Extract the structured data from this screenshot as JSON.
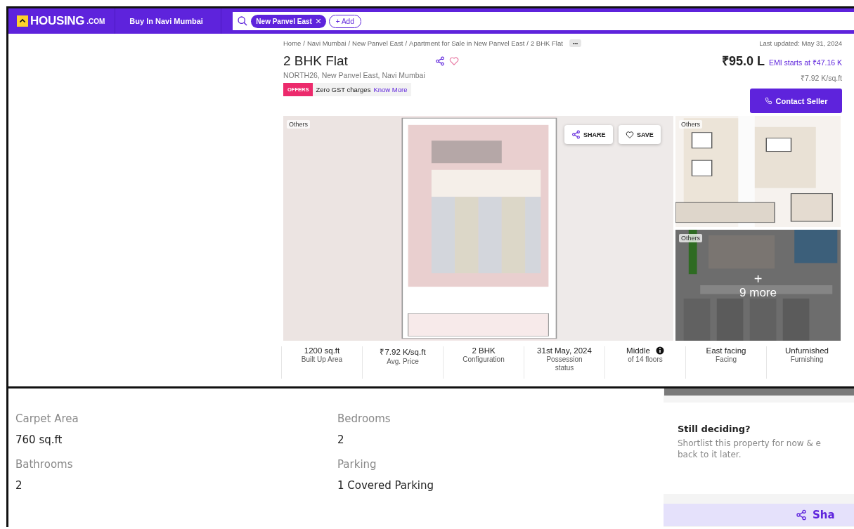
{
  "nav": {
    "logo": "HOUSING",
    "logo_suffix": ".COM",
    "menu": "Buy In Navi Mumbai",
    "search_chips": [
      {
        "label": "New Panvel East"
      }
    ],
    "add_button": "+ Add"
  },
  "breadcrumb": {
    "items": [
      "Home",
      "Navi Mumbai",
      "New Panvel East",
      "Apartment for Sale in New Panvel East",
      "2 BHK Flat"
    ],
    "separator": "/",
    "more": "•••"
  },
  "last_updated": "Last updated: May 31, 2024",
  "listing": {
    "title": "2 BHK Flat",
    "address": "NORTH26, New Panvel East, Navi Mumbai",
    "offer_badge": "OFFERS",
    "offer_text": "Zero GST charges",
    "offer_link": "Know More"
  },
  "price": {
    "amount": "₹95.0 L",
    "emi": "EMI starts at ₹47.16 K",
    "per_sqft": "₹7.92 K/sq.ft",
    "contact_button": "Contact Seller"
  },
  "gallery": {
    "main": {
      "label": "Others",
      "kind": "plan"
    },
    "share_button": "SHARE",
    "save_button": "SAVE",
    "side": [
      {
        "label": "Others",
        "kind": "floorplan"
      },
      {
        "label": "Others",
        "kind": "darkplan",
        "more_icon": "+",
        "more": "9 more"
      }
    ]
  },
  "stats": [
    {
      "value": "1200 sq.ft",
      "label": "Built Up Area",
      "info": false
    },
    {
      "value": "₹7.92 K/sq.ft",
      "label": "Avg. Price",
      "info": false
    },
    {
      "value": "2 BHK",
      "label": "Configuration",
      "info": false
    },
    {
      "value": "31st May, 2024",
      "label": "Possession status",
      "info": false
    },
    {
      "value": "Middle",
      "label": "of 14 floors",
      "info": true
    },
    {
      "value": "East facing",
      "label": "Facing",
      "info": false
    },
    {
      "value": "Unfurnished",
      "label": "Furnishing",
      "info": false
    }
  ],
  "details": [
    {
      "label": "Carpet Area",
      "value": "760 sq.ft"
    },
    {
      "label": "Bedrooms",
      "value": "2"
    },
    {
      "label": "Bathrooms",
      "value": "2"
    },
    {
      "label": "Parking",
      "value": "1 Covered Parking"
    }
  ],
  "side_panel": {
    "title": "Still deciding?",
    "lines": [
      "Shortlist this property for now & e",
      "back to it later."
    ],
    "share_button": "Sha"
  }
}
